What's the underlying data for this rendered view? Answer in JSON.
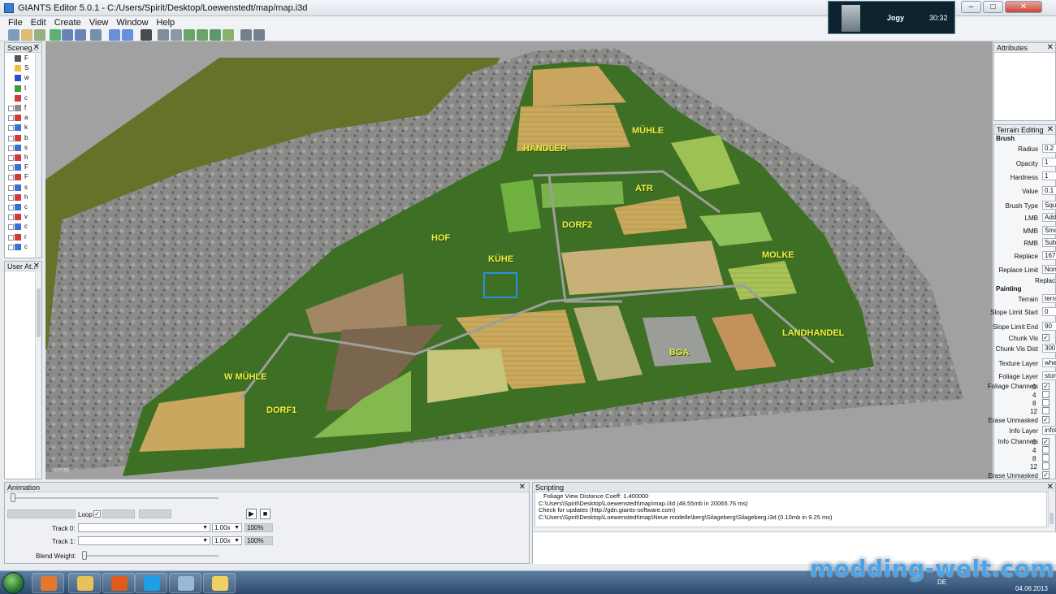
{
  "window": {
    "title": "GIANTS Editor 5.0.1 - C:/Users/Spirit/Desktop/Loewenstedt/map/map.i3d",
    "minimize": "–",
    "maximize": "□",
    "close": "✕"
  },
  "menu": [
    "File",
    "Edit",
    "Create",
    "View",
    "Window",
    "Help"
  ],
  "toolbar_icons": [
    "new-icon",
    "open-icon",
    "import-icon",
    "reload-icon",
    "save-icon",
    "save-as-icon",
    "export-icon",
    "undo-icon",
    "redo-icon",
    "play-icon",
    "select-icon",
    "move-icon",
    "terrain-sculpt-icon",
    "terrain-paint-icon",
    "foliage-paint-icon",
    "decal-icon",
    "settings-icon",
    "render-icon"
  ],
  "notification": {
    "user": "Jogy",
    "time": "30:32"
  },
  "scenegraph": {
    "title": "Sceneg...",
    "rows": [
      {
        "label": "F",
        "color": "#555555",
        "plus": false
      },
      {
        "label": "S",
        "color": "#e8c23a",
        "plus": false
      },
      {
        "label": "w",
        "color": "#2f4fd0",
        "plus": false
      },
      {
        "label": "t",
        "color": "#3e9a3a",
        "plus": false
      },
      {
        "label": "c",
        "color": "#d23a3a",
        "plus": false
      },
      {
        "label": "f",
        "color": "#8a8a8a",
        "plus": true
      },
      {
        "label": "a",
        "color": "#d23a3a",
        "plus": true
      },
      {
        "label": "k",
        "color": "#3a6fd2",
        "plus": true
      },
      {
        "label": "b",
        "color": "#d23a3a",
        "plus": true
      },
      {
        "label": "s",
        "color": "#3a6fd2",
        "plus": true
      },
      {
        "label": "h",
        "color": "#d23a3a",
        "plus": true
      },
      {
        "label": "F",
        "color": "#3a6fd2",
        "plus": true
      },
      {
        "label": "F",
        "color": "#d23a3a",
        "plus": true
      },
      {
        "label": "s",
        "color": "#3a6fd2",
        "plus": true
      },
      {
        "label": "h",
        "color": "#d23a3a",
        "plus": true
      },
      {
        "label": "c",
        "color": "#3a6fd2",
        "plus": true
      },
      {
        "label": "v",
        "color": "#d23a3a",
        "plus": true
      },
      {
        "label": "c",
        "color": "#3a6fd2",
        "plus": true
      },
      {
        "label": "r",
        "color": "#d23a3a",
        "plus": true
      },
      {
        "label": "c",
        "color": "#3a6fd2",
        "plus": true
      }
    ]
  },
  "user_attributes": {
    "title": "User At..."
  },
  "viewport": {
    "camera": "persp",
    "labels": [
      "MÜHLE",
      "HÄNDLER",
      "ATR",
      "DORF2",
      "HOF",
      "KÜHE",
      "MOLKE",
      "LANDHANDEL",
      "BGA",
      "W MÜHLE",
      "DORF1"
    ]
  },
  "attributes": {
    "title": "Attributes"
  },
  "terrain_editing": {
    "title": "Terrain Editing",
    "brush_section": "Brush",
    "radius_label": "Radius",
    "radius": "0.2",
    "opacity_label": "Opacity",
    "opacity": "1",
    "hardness_label": "Hardness",
    "hardness": "1",
    "value_label": "Value",
    "value": "0.1",
    "brush_type_label": "Brush Type",
    "brush_type": "Squa",
    "lmb_label": "LMB",
    "lmb": "Add",
    "mmb_label": "MMB",
    "mmb": "Smoo",
    "rmb_label": "RMB",
    "rmb": "Sub",
    "replace_label": "Replace",
    "replace": "167.",
    "replace_limit_label": "Replace Limit",
    "replace_limit": "None",
    "replace_button": "Replac",
    "painting_section": "Painting",
    "terrain_label": "Terrain",
    "terrain": "terrai",
    "slope_start_label": "Slope Limit Start",
    "slope_start": "0",
    "slope_end_label": "Slope Limit End",
    "slope_end": "90",
    "chunk_vis_label": "Chunk Vis",
    "chunk_vis_dist_label": "Chunk Vis Dist",
    "chunk_vis_dist": "300",
    "texture_layer_label": "Texture Layer",
    "texture_layer": "wheat",
    "foliage_layer_label": "Foliage Layer",
    "foliage_layer": "stone",
    "foliage_channels_label": "Foliage Channels",
    "foliage_channels": [
      "0",
      "4",
      "8",
      "12"
    ],
    "erase_unmasked_label": "Erase Unmasked",
    "info_layer_label": "Info Layer",
    "info_layer": "infoL",
    "info_channels_label": "Info Channels",
    "info_channels": [
      "0",
      "4",
      "8",
      "12"
    ],
    "erase_unmasked2_label": "Erase Unmasked"
  },
  "animation": {
    "title": "Animation",
    "loop_label": "Loop",
    "track0_label": "Track 0:",
    "track0_speed": "1.00x",
    "track0_pct": "100%",
    "track1_label": "Track 1:",
    "track1_speed": "1.00x",
    "track1_pct": "100%",
    "blend_label": "Blend Weight:"
  },
  "scripting": {
    "title": "Scripting",
    "lines": [
      "Foliage View Distance Coeff: 1.400000",
      "C:\\Users\\Spirit\\Desktop\\Loewenstedt\\map\\map.i3d (48.55mb in 20065.76 ms)",
      "Check for updates (http://gdn.giants-software.com)",
      "C:\\Users\\Spirit\\Desktop\\Loewenstedt\\map\\Neue modelle\\berg\\Silageberg\\Silageberg.i3d (0.10mb in 9.25 ms)"
    ]
  },
  "taskbar": {
    "apps": [
      {
        "name": "media-player",
        "color": "#e6772e"
      },
      {
        "name": "explorer",
        "color": "#e8c15a"
      },
      {
        "name": "firefox",
        "color": "#e05a1e"
      },
      {
        "name": "skype",
        "color": "#1ea0e6"
      },
      {
        "name": "editor",
        "color": "#9bb8d6"
      },
      {
        "name": "giants-editor",
        "color": "#f0d060"
      }
    ],
    "lang": "DE",
    "date": "04.06.2013"
  },
  "watermark": "modding-welt.com"
}
